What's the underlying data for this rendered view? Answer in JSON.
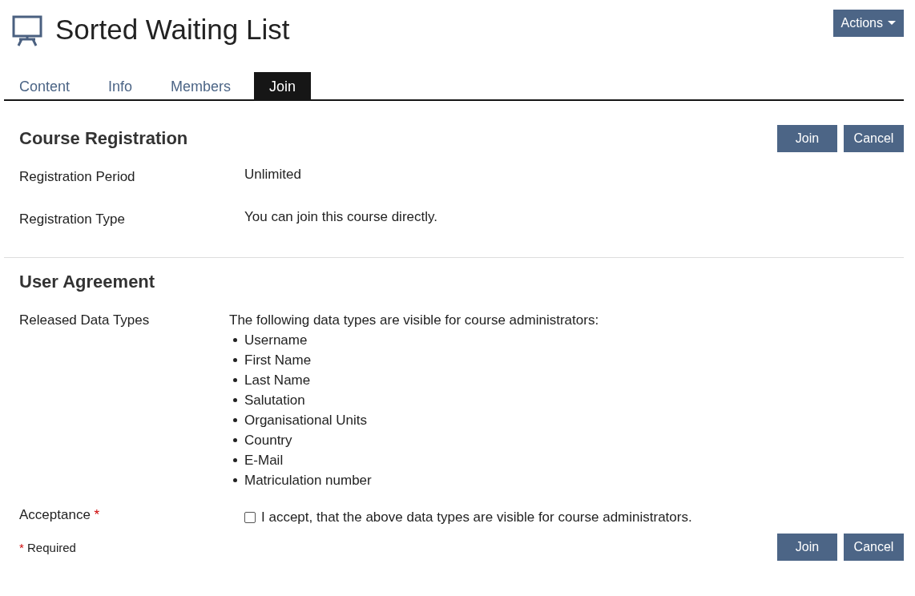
{
  "header": {
    "title": "Sorted Waiting List",
    "actions_button": "Actions"
  },
  "tabs": [
    {
      "label": "Content",
      "selected": false
    },
    {
      "label": "Info",
      "selected": false
    },
    {
      "label": "Members",
      "selected": false
    },
    {
      "label": "Join",
      "selected": true
    }
  ],
  "registration": {
    "heading": "Course Registration",
    "buttons": [
      "Join",
      "Cancel"
    ],
    "rows": [
      {
        "label": "Registration Period",
        "value": "Unlimited"
      },
      {
        "label": "Registration Type",
        "value": "You can join this course directly."
      }
    ]
  },
  "agreement": {
    "heading": "User Agreement",
    "data_types_label": "Released Data Types",
    "intro": "The following data types are visible for course administrators:",
    "data_types": [
      "Username",
      "First Name",
      "Last Name",
      "Salutation",
      "Organisational Units",
      "Country",
      "E-Mail",
      "Matriculation number"
    ],
    "acceptance": {
      "label": "Acceptance",
      "required_mark": "*",
      "checkbox_label": "I accept, that the above data types are visible for course administrators.",
      "checked": false
    }
  },
  "footer": {
    "required_mark": "*",
    "required_text": "Required",
    "buttons": [
      "Join",
      "Cancel"
    ]
  }
}
